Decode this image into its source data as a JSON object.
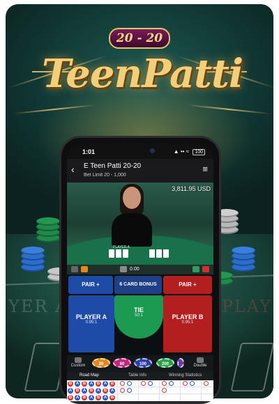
{
  "logo": {
    "badge": "20 - 20",
    "title": "TeenPatti"
  },
  "phone": {
    "status": {
      "time": "1:01",
      "network": "▲ •• ≈",
      "battery": "100"
    },
    "header": {
      "title": "E Teen Patti 20-20",
      "bet_limit": "Bet Limit 20 - 1,000"
    },
    "balance": "3,811.95 USD",
    "video_labels": {
      "player_a": "PLAYER A"
    },
    "total_bet": "0.00",
    "bets": {
      "pair_plus_a": "PAIR +",
      "six_card_bonus": "6 CARD BONUS",
      "pair_plus_b": "PAIR +",
      "player_a": {
        "label": "PLAYER A",
        "odds": "0.95:1"
      },
      "tie": {
        "label": "TIE",
        "odds": "50:1"
      },
      "player_b": {
        "label": "PLAYER B",
        "odds": "0.95:1"
      }
    },
    "chips": [
      "20",
      "60",
      "100",
      "200"
    ],
    "controls": {
      "custom": "Custom",
      "double": "Double"
    },
    "tabs": [
      "Road Map",
      "Table Info",
      "Winning Statistics"
    ]
  },
  "background": {
    "felt_left": "YER A",
    "felt_right": "PLAY"
  },
  "colors": {
    "pair_blue": "#1e4aa8",
    "bonus_blue": "#1f3f86",
    "pair_red": "#b31f1f",
    "tie_green": "#1c9a52",
    "gold": "#f3cf7a"
  }
}
